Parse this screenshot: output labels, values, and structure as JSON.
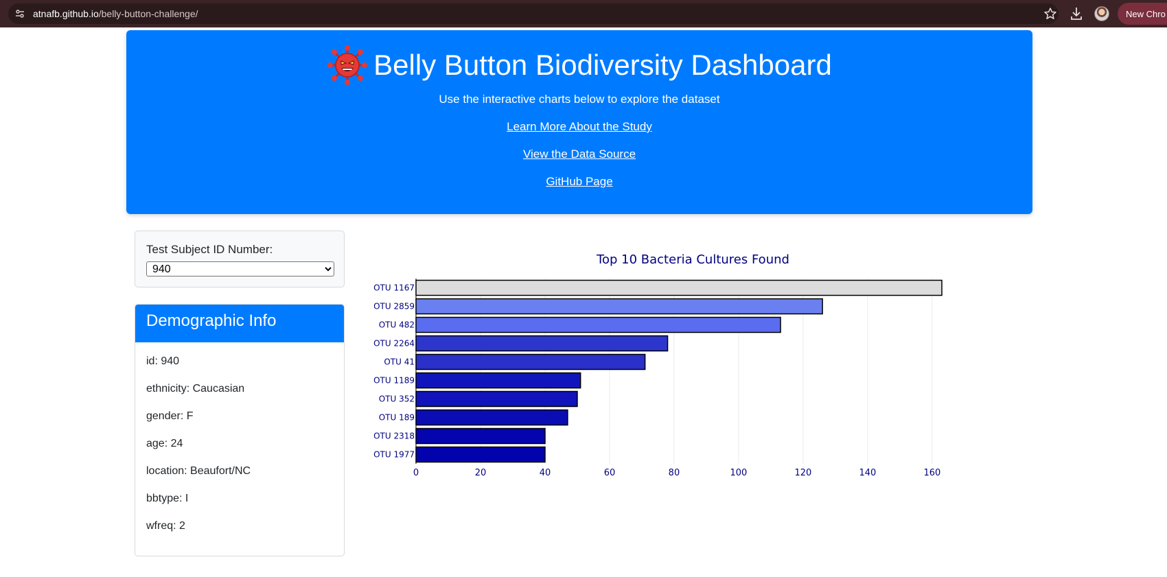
{
  "browser": {
    "url_host": "atnafb.github.io",
    "url_path": "/belly-button-challenge/",
    "new_chrome_label": "New Chro"
  },
  "header": {
    "title": "Belly Button Biodiversity Dashboard",
    "subtitle": "Use the interactive charts below to explore the dataset",
    "links": [
      "Learn More About the Study",
      "View the Data Source",
      "GitHub Page"
    ]
  },
  "selector": {
    "label": "Test Subject ID Number:",
    "selected": "940"
  },
  "demographics": {
    "title": "Demographic Info",
    "lines": [
      "id: 940",
      "ethnicity: Caucasian",
      "gender: F",
      "age: 24",
      "location: Beaufort/NC",
      "bbtype: I",
      "wfreq: 2"
    ]
  },
  "colors": {
    "primary": "#007bff",
    "chart_text": "#000080"
  },
  "chart_data": {
    "type": "bar",
    "orientation": "horizontal",
    "title": "Top 10 Bacteria Cultures Found",
    "categories": [
      "OTU 1167",
      "OTU 2859",
      "OTU 482",
      "OTU 2264",
      "OTU 41",
      "OTU 1189",
      "OTU 352",
      "OTU 189",
      "OTU 2318",
      "OTU 1977"
    ],
    "values": [
      163,
      126,
      113,
      78,
      71,
      51,
      50,
      47,
      40,
      40
    ],
    "bar_colors": [
      "#dcdcdc",
      "#6a80f0",
      "#5a6cf0",
      "#2d36cc",
      "#2a30c8",
      "#1116bc",
      "#1014ba",
      "#0b0db4",
      "#0505b0",
      "#0303ae"
    ],
    "xticks": [
      0,
      20,
      40,
      60,
      80,
      100,
      120,
      140,
      160
    ],
    "xlim": [
      0,
      163
    ],
    "grid": true
  }
}
